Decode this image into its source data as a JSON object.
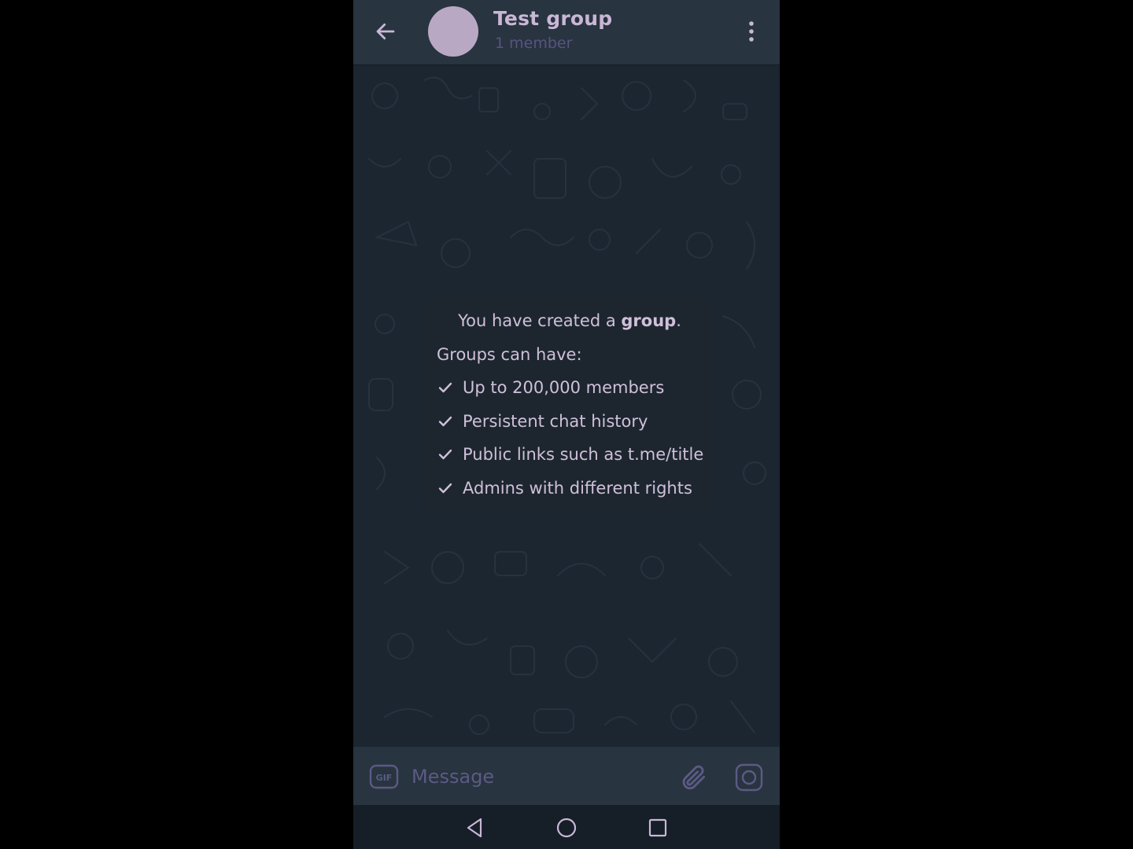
{
  "header": {
    "back_icon": "arrow-left-icon",
    "title": "Test group",
    "subtitle": "1 member",
    "menu_icon": "more-vertical-icon",
    "avatar_color": "#b9a8c4"
  },
  "service_message": {
    "headline_prefix": "You have created a ",
    "headline_bold": "group",
    "headline_suffix": ".",
    "subheading": "Groups can have:",
    "features": [
      "Up to 200,000 members",
      "Persistent chat history",
      "Public links such as t.me/title",
      "Admins with different rights"
    ],
    "check_icon": "checkmark-icon"
  },
  "input_bar": {
    "gif_icon": "gif-icon",
    "gif_label": "GIF",
    "placeholder": "Message",
    "attach_icon": "paperclip-icon",
    "camera_icon": "camera-icon"
  },
  "navbar": {
    "back_icon": "nav-back-triangle-icon",
    "home_icon": "nav-home-circle-icon",
    "recent_icon": "nav-recents-square-icon"
  },
  "colors": {
    "header_bg": "#28343f",
    "chat_bg": "#1b2631",
    "accent_text": "#c9b7d6",
    "muted_text": "#5a5382"
  }
}
